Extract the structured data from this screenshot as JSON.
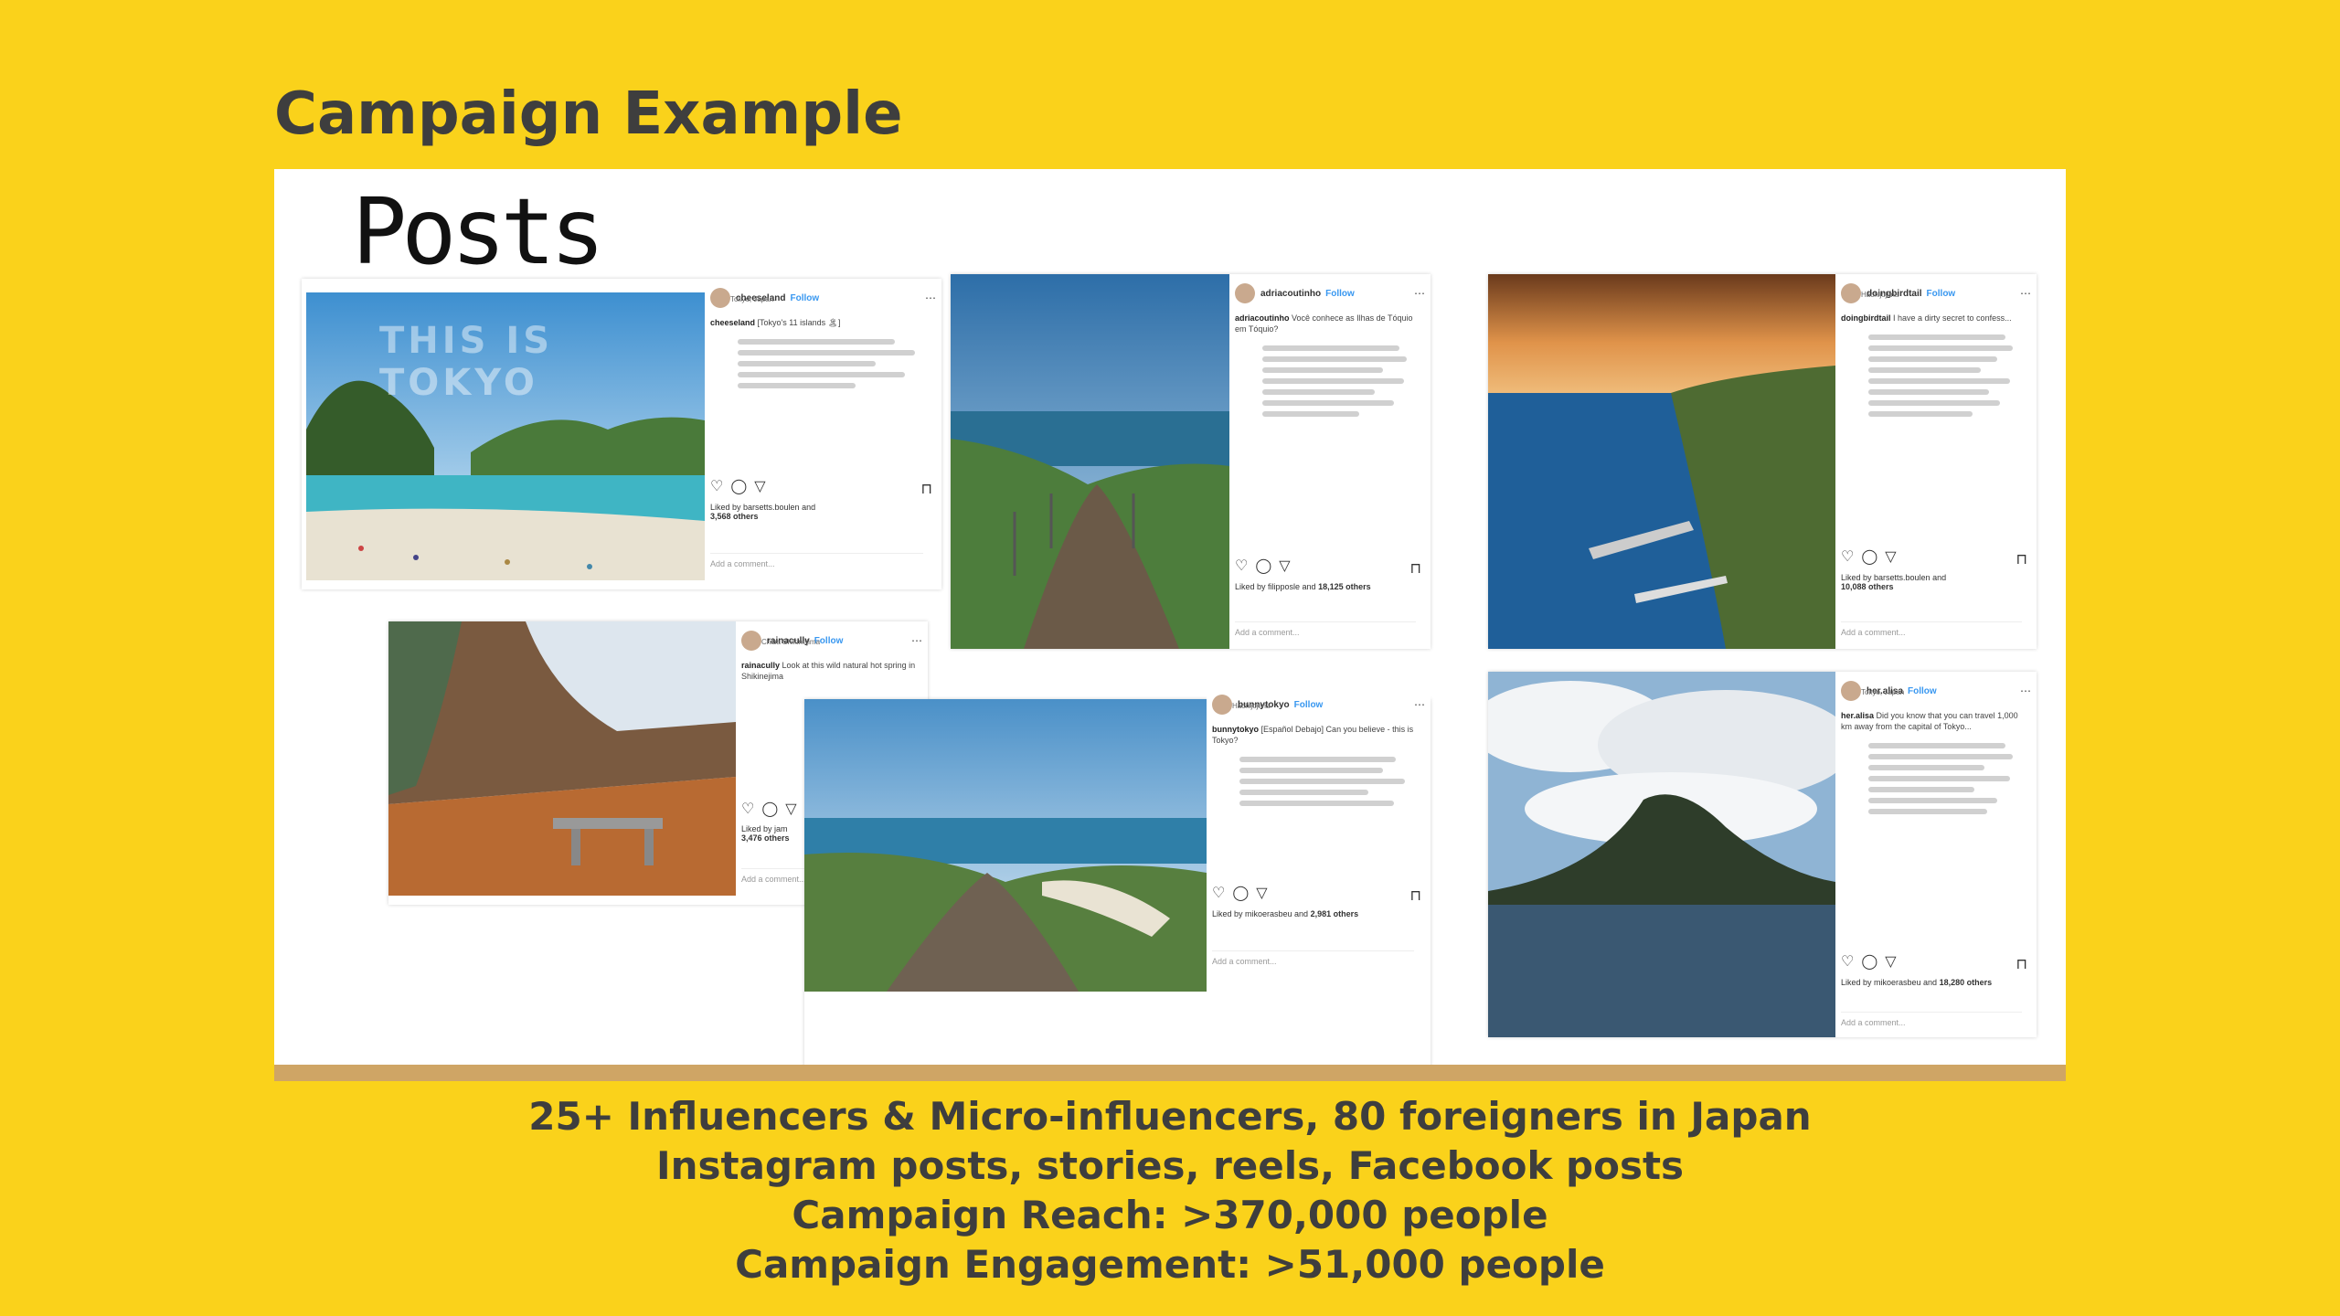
{
  "header": {
    "title": "Campaign Example"
  },
  "panel": {
    "heading": "Posts",
    "posts": [
      {
        "username": "cheeseland",
        "location": "Tokyo, Japan",
        "follow": "Follow",
        "caption_user": "cheeseland",
        "caption": "[Tokyo's 11 islands 🏝]",
        "liked": "Liked by barsetts.boulen and",
        "likes": "3,568 others",
        "comment": "Add a comment...",
        "overlay": "THIS IS TOKYO"
      },
      {
        "username": "adriacoutinho",
        "location": "",
        "follow": "Follow",
        "caption_user": "adriacoutinho",
        "caption": "Você conhece as Ilhas de Tóquio em Tóquio?",
        "liked": "Liked by filipposle and",
        "likes": "18,125 others",
        "comment": "Add a comment..."
      },
      {
        "username": "doingbirdtail",
        "location": "Hachijojima",
        "follow": "Follow",
        "caption_user": "doingbirdtail",
        "caption": "I have a dirty secret to confess...",
        "liked": "Liked by barsetts.boulen and",
        "likes": "10,088 others",
        "comment": "Add a comment..."
      },
      {
        "username": "rainacully",
        "location": "Chiba Shikinejima",
        "follow": "Follow",
        "caption_user": "rainacully",
        "caption": "Look at this wild natural hot spring in Shikinejima",
        "liked": "Liked by jam",
        "likes": "3,476 others",
        "comment": "Add a comment..."
      },
      {
        "username": "bunnytokyo",
        "location": "Hachijojima",
        "follow": "Follow",
        "caption_user": "bunnytokyo",
        "caption": "[Español Debajo] Can you believe - this is Tokyo?",
        "liked": "Liked by mikoerasbeu and",
        "likes": "2,981 others",
        "comment": "Add a comment..."
      },
      {
        "username": "her.alisa",
        "location": "Tokyo, Japan",
        "follow": "Follow",
        "caption_user": "her.alisa",
        "caption": "Did you know that you can travel 1,000 km away from the capital of Tokyo...",
        "liked": "Liked by mikoerasbeu and",
        "likes": "18,280 others",
        "comment": "Add a comment..."
      }
    ]
  },
  "summary": {
    "line1": "25+ Influencers & Micro-influencers, 80 foreigners in Japan",
    "line2": "Instagram posts, stories, reels, Facebook posts",
    "line3": "Campaign Reach: >370,000 people",
    "line4": "Campaign Engagement: >51,000 people"
  },
  "colors": {
    "background": "#FAD21B",
    "title": "#3E3E3E",
    "bar": "#CFA565",
    "link": "#3897f0"
  },
  "icons": [
    "heart-icon",
    "comment-icon",
    "share-icon",
    "bookmark-icon",
    "more-icon"
  ]
}
